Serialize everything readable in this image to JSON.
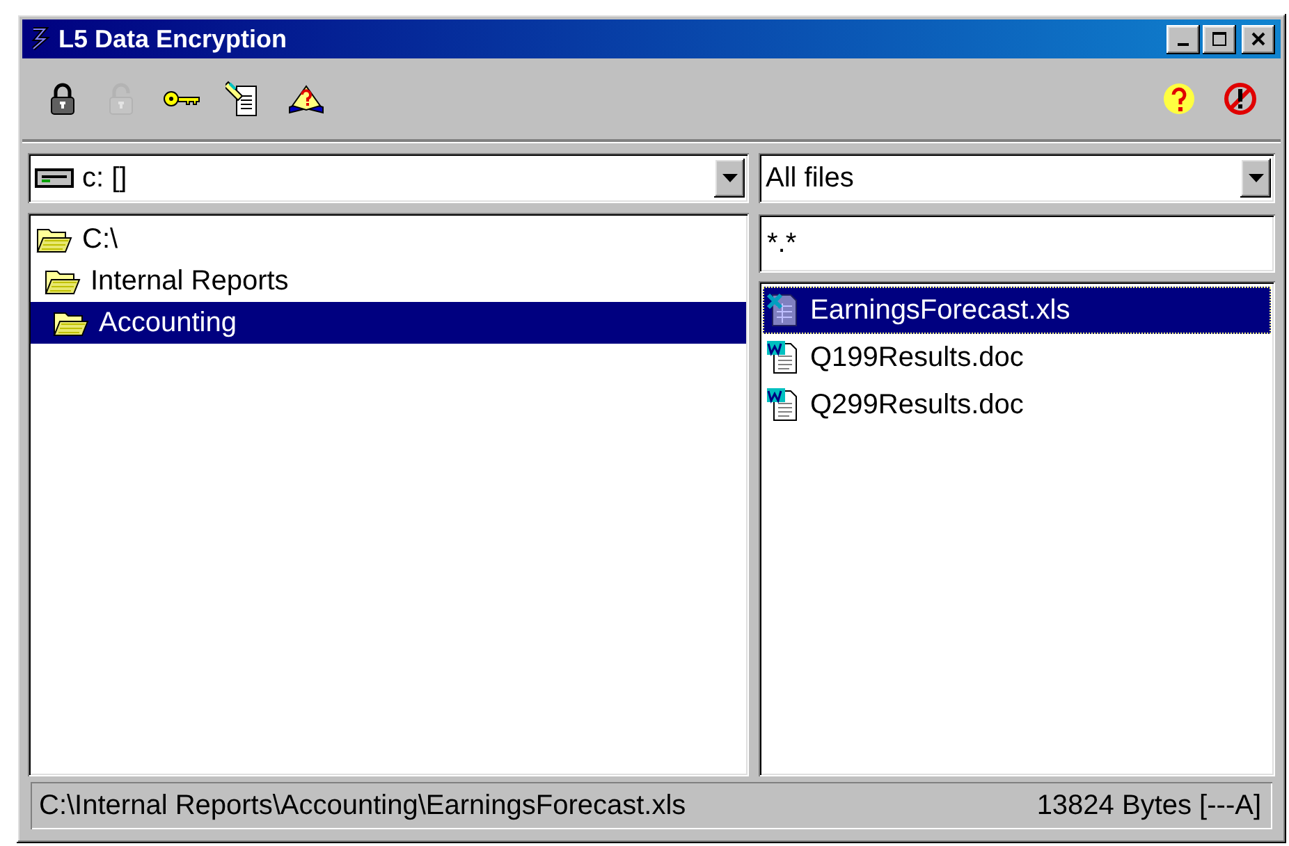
{
  "window": {
    "title": "L5 Data Encryption"
  },
  "toolbar": {
    "left": [
      {
        "kind": "lock",
        "disabled": false
      },
      {
        "kind": "unlock",
        "disabled": true
      },
      {
        "kind": "key",
        "disabled": false
      },
      {
        "kind": "document",
        "disabled": false
      },
      {
        "kind": "helpbook",
        "disabled": false
      }
    ],
    "right": [
      {
        "kind": "help",
        "disabled": false
      },
      {
        "kind": "exit",
        "disabled": false
      }
    ]
  },
  "drive_combo": {
    "value": "c: []"
  },
  "type_combo": {
    "value": "All files"
  },
  "filter": {
    "value": "*.*"
  },
  "folders": [
    {
      "label": "C:\\",
      "selected": false,
      "children": [
        {
          "label": "Internal Reports",
          "selected": false,
          "children": [
            {
              "label": "Accounting",
              "selected": true
            }
          ]
        }
      ]
    }
  ],
  "files": [
    {
      "name": "EarningsForecast.xls",
      "kind": "spreadsheet",
      "selected": true
    },
    {
      "name": "Q199Results.doc",
      "kind": "document",
      "selected": false
    },
    {
      "name": "Q299Results.doc",
      "kind": "document",
      "selected": false
    }
  ],
  "status_bar": {
    "path": "C:\\Internal Reports\\Accounting\\EarningsForecast.xls",
    "info": "13824 Bytes [---A]"
  }
}
